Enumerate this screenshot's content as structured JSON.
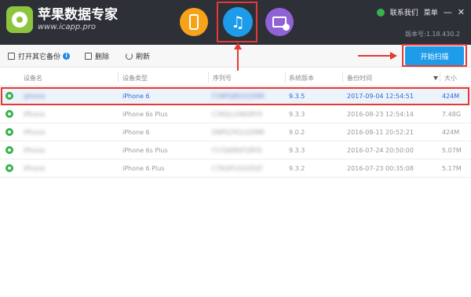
{
  "app": {
    "title": "苹果数据专家",
    "site": "www.icapp.pro",
    "version": "版本号:1.18.430.2",
    "contact": "联系我们",
    "menu": "菜单",
    "minimize": "—",
    "close": "✕"
  },
  "modules": [
    {
      "name": "phone",
      "icon": "phone-icon",
      "color": "#f6a31a"
    },
    {
      "name": "music",
      "icon": "music-note-icon",
      "color": "#1e9be9",
      "selected": true
    },
    {
      "name": "history",
      "icon": "history-icon",
      "color": "#8f62d6"
    }
  ],
  "toolbar": {
    "open_backup": "打开其它备份",
    "delete": "删除",
    "refresh": "刷新",
    "start_scan": "开始扫描"
  },
  "table": {
    "headers": [
      "设备名",
      "设备类型",
      "序列号",
      "系统版本",
      "备份时间",
      "大小"
    ],
    "rows": [
      {
        "name": "iphone",
        "type": "iPhone 6",
        "serial": "F2NPQ8D1G5MR",
        "os": "9.3.5",
        "time": "2017-09-04 12:54:51",
        "size": "424M",
        "selected": true
      },
      {
        "name": "iPhone",
        "type": "iPhone 6s Plus",
        "serial": "C39QL2H6GRY9",
        "os": "9.3.3",
        "time": "2016-08-23 12:54:14",
        "size": "7.48G"
      },
      {
        "name": "iPhone",
        "type": "iPhone 6",
        "serial": "DNPQ7K2LG5MR",
        "os": "9.0.2",
        "time": "2016-08-11 20:52:21",
        "size": "424M"
      },
      {
        "name": "iPhone",
        "type": "iPhone 6s Plus",
        "serial": "F17QK8HFGRY9",
        "os": "9.3.3",
        "time": "2016-07-24 20:50:00",
        "size": "5.07M"
      },
      {
        "name": "iPhone",
        "type": "iPhone 6 Plus",
        "serial": "C7KQP1X2G5QT",
        "os": "9.3.2",
        "time": "2016-07-23 00:35:08",
        "size": "5.17M"
      }
    ]
  }
}
